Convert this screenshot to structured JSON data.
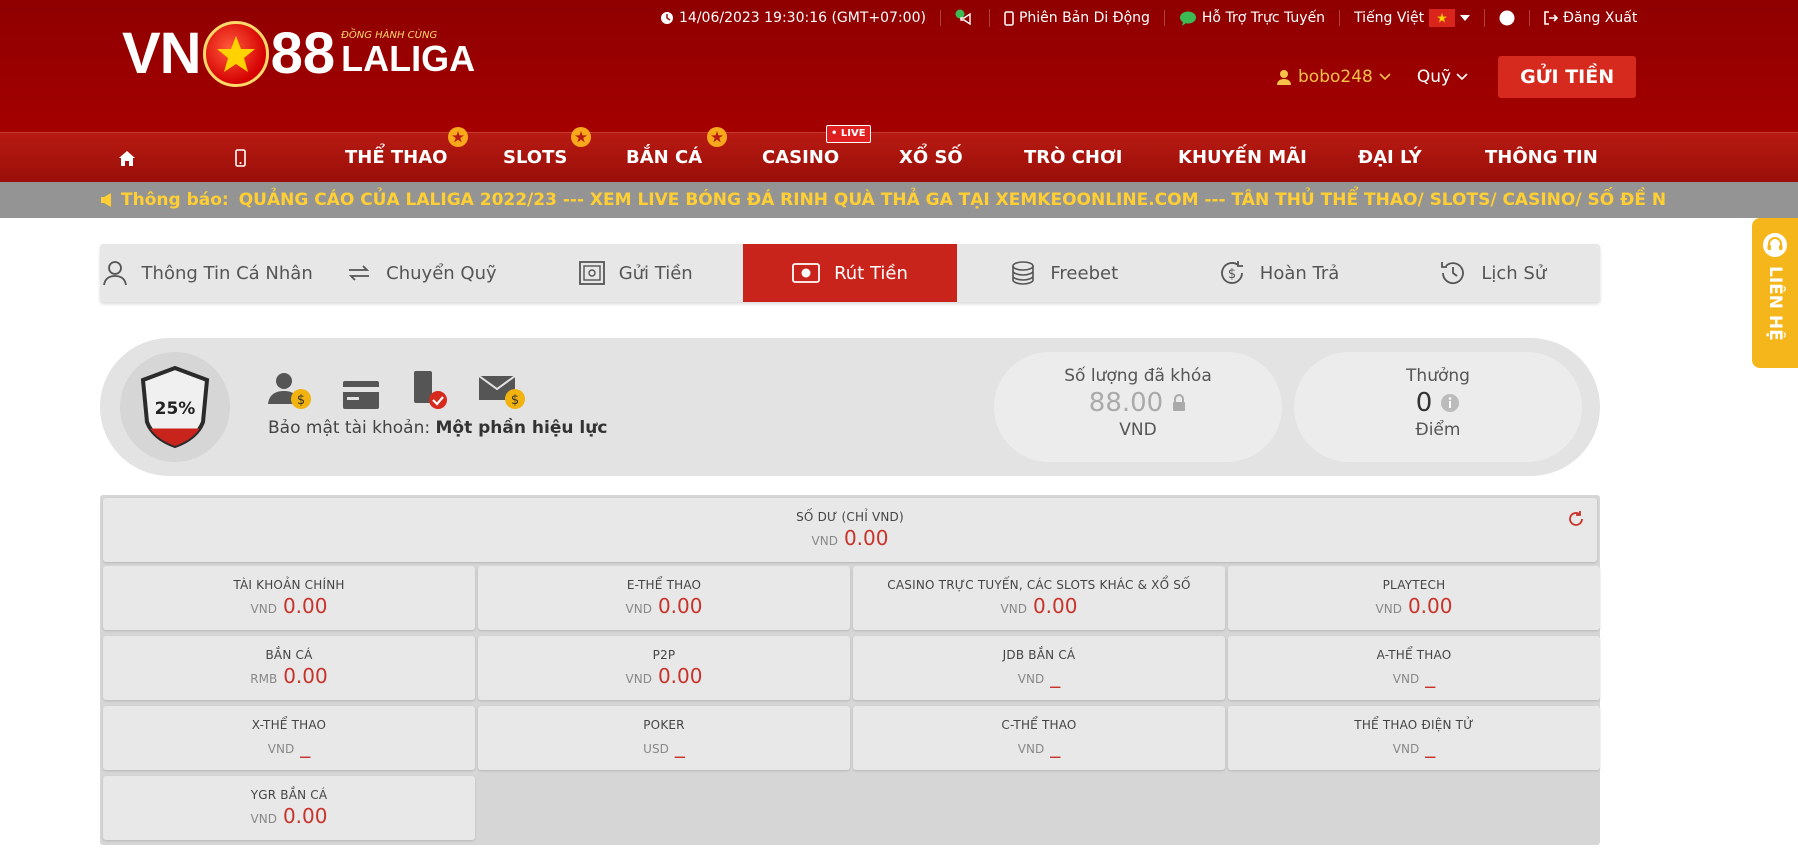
{
  "header": {
    "logo": {
      "vn": "VN",
      "num": "88",
      "slogan": "ĐỒNG HÀNH CÙNG",
      "laliga": "LALIGA"
    },
    "datetime": "14/06/2023 19:30:16 (GMT+07:00)",
    "mobile_label": "Phiên Bản Di Động",
    "support_label": "Hỗ Trợ Trực Tuyến",
    "language_label": "Tiếng Việt",
    "logout_label": "Đăng Xuất",
    "username": "bobo248",
    "fund_label": "Quỹ",
    "deposit_button": "GỬI TIỀN"
  },
  "nav": {
    "items": [
      "THỂ THAO",
      "SLOTS",
      "BẮN CÁ",
      "CASINO",
      "XỔ SỐ",
      "TRÒ CHƠI",
      "KHUYẾN MÃI",
      "ĐẠI LÝ",
      "THÔNG TIN"
    ],
    "live_badge": "• LIVE"
  },
  "notice": {
    "label": "Thông báo:",
    "text": "QUẢNG CÁO CỦA LALIGA 2022/23 --- XEM LIVE BÓNG ĐÁ RINH QUÀ THẢ GA TẠI XEMKEOONLINE.COM --- TÂN THỦ THỂ THAO/ SLOTS/ CASINO/ SỐ ĐỀ N"
  },
  "contact_tab": "LIÊN HỆ",
  "tabs": [
    "Thông Tin Cá Nhân",
    "Chuyển Quỹ",
    "Gửi Tiền",
    "Rút Tiền",
    "Freebet",
    "Hoàn Trả",
    "Lịch Sử"
  ],
  "active_tab": "Rút Tiền",
  "security": {
    "percent": "25%",
    "percent_value": 25,
    "label": "Bảo mật tài khoản:",
    "status": "Một phần hiệu lực"
  },
  "locked": {
    "title": "Số lượng đã khóa",
    "value": "88.00",
    "unit": "VND"
  },
  "bonus": {
    "title": "Thưởng",
    "value": "0",
    "unit": "Điểm"
  },
  "balance_total": {
    "name": "SỐ DƯ (CHỈ VND)",
    "currency": "VND",
    "amount": "0.00"
  },
  "wallets": [
    {
      "name": "TÀI KHOẢN CHÍNH",
      "currency": "VND",
      "amount": "0.00"
    },
    {
      "name": "E-THỂ THAO",
      "currency": "VND",
      "amount": "0.00"
    },
    {
      "name": "CASINO TRỰC TUYẾN, CÁC SLOTS KHÁC & XỔ SỐ",
      "currency": "VND",
      "amount": "0.00"
    },
    {
      "name": "PLAYTECH",
      "currency": "VND",
      "amount": "0.00"
    },
    {
      "name": "BẮN CÁ",
      "currency": "RMB",
      "amount": "0.00"
    },
    {
      "name": "P2P",
      "currency": "VND",
      "amount": "0.00"
    },
    {
      "name": "JDB BẮN CÁ",
      "currency": "VND",
      "amount": "_"
    },
    {
      "name": "A-THỂ THAO",
      "currency": "VND",
      "amount": "_"
    },
    {
      "name": "X-THỂ THAO",
      "currency": "VND",
      "amount": "_"
    },
    {
      "name": "POKER",
      "currency": "USD",
      "amount": "_"
    },
    {
      "name": "C-THỂ THAO",
      "currency": "VND",
      "amount": "_"
    },
    {
      "name": "THỂ THAO ĐIỆN TỬ",
      "currency": "VND",
      "amount": "_"
    },
    {
      "name": "YGR BẮN CÁ",
      "currency": "VND",
      "amount": "0.00"
    }
  ]
}
